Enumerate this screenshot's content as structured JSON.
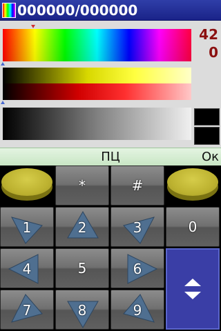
{
  "title_bar": {
    "title": "000000/000000",
    "icon": "color-palette-icon"
  },
  "picker": {
    "value_top": "42",
    "value_bottom": "0"
  },
  "softkeys": {
    "center_label": "ПЦ",
    "right_label": "Ок"
  },
  "keypad": {
    "star": "*",
    "hash": "#",
    "k0": "0",
    "k1": "1",
    "k2": "2",
    "k3": "3",
    "k4": "4",
    "k5": "5",
    "k6": "6",
    "k7": "7",
    "k8": "8",
    "k9": "9"
  },
  "icons": {
    "scroll": "up-down-arrows-icon",
    "left_softkey": "yellow-disc-icon",
    "right_softkey": "yellow-disc-icon"
  },
  "colors": {
    "title_bar": "#2430a0",
    "softkey_bar": "#d4ecd0",
    "value_text": "#8b1010",
    "scroll_key": "#3a3ea6",
    "softkey_disc": "#c8bd38",
    "arrow_fill": "#4f6f90"
  }
}
